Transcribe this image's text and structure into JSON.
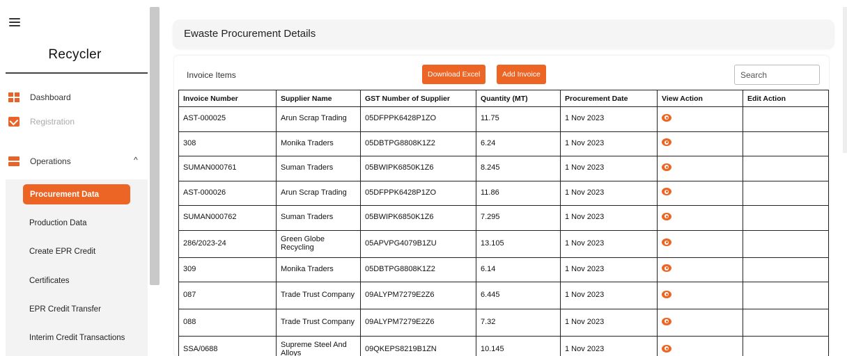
{
  "sidebar": {
    "brand": "Recycler",
    "nav": [
      {
        "label": "Dashboard"
      },
      {
        "label": "Registration"
      },
      {
        "label": "Operations"
      }
    ],
    "operations_items": [
      {
        "label": "Procurement Data"
      },
      {
        "label": "Production Data"
      },
      {
        "label": "Create EPR Credit"
      },
      {
        "label": "Certificates"
      },
      {
        "label": "EPR Credit Transfer"
      },
      {
        "label": "Interim Credit Transactions"
      }
    ]
  },
  "page": {
    "title": "Ewaste Procurement Details",
    "section_label": "Invoice Items",
    "download_label": "Download Excel",
    "add_label": "Add Invoice",
    "search_placeholder": "Search"
  },
  "table": {
    "columns": [
      "Invoice Number",
      "Supplier Name",
      "GST Number of Supplier",
      "Quantity (MT)",
      "Procurement Date",
      "View Action",
      "Edit Action"
    ],
    "rows": [
      {
        "invoice": "AST-000025",
        "supplier": "Arun Scrap Trading",
        "gst": "05DFPPK6428P1ZO",
        "qty": "11.75",
        "date": "1 Nov 2023"
      },
      {
        "invoice": "308",
        "supplier": "Monika Traders",
        "gst": "05DBTPG8808K1Z2",
        "qty": "6.24",
        "date": "1 Nov 2023"
      },
      {
        "invoice": "SUMAN000761",
        "supplier": "Suman Traders",
        "gst": "05BWIPK6850K1Z6",
        "qty": "8.245",
        "date": "1 Nov 2023"
      },
      {
        "invoice": "AST-000026",
        "supplier": "Arun Scrap Trading",
        "gst": "05DFPPK6428P1ZO",
        "qty": "11.86",
        "date": "1 Nov 2023"
      },
      {
        "invoice": "SUMAN000762",
        "supplier": "Suman Traders",
        "gst": "05BWIPK6850K1Z6",
        "qty": "7.295",
        "date": "1 Nov 2023"
      },
      {
        "invoice": "286/2023-24",
        "supplier": "Green Globe Recycling",
        "gst": "05APVPG4079B1ZU",
        "qty": "13.105",
        "date": "1 Nov 2023"
      },
      {
        "invoice": "309",
        "supplier": "Monika Traders",
        "gst": "05DBTPG8808K1Z2",
        "qty": "6.14",
        "date": "1 Nov 2023"
      },
      {
        "invoice": "087",
        "supplier": "Trade Trust Company",
        "gst": "09ALYPM7279E2Z6",
        "qty": "6.445",
        "date": "1 Nov 2023"
      },
      {
        "invoice": "088",
        "supplier": "Trade Trust Company",
        "gst": "09ALYPM7279E2Z6",
        "qty": "7.32",
        "date": "1 Nov 2023"
      },
      {
        "invoice": "SSA/0688",
        "supplier": "Supreme Steel And Alloys",
        "gst": "09QKEPS8219B1ZN",
        "qty": "10.145",
        "date": "1 Nov 2023"
      }
    ]
  },
  "colors": {
    "accent": "#ec6524"
  },
  "icons": {
    "view": "eye-icon",
    "menu": "hamburger-icon",
    "collapse": "chevron-up-icon"
  }
}
